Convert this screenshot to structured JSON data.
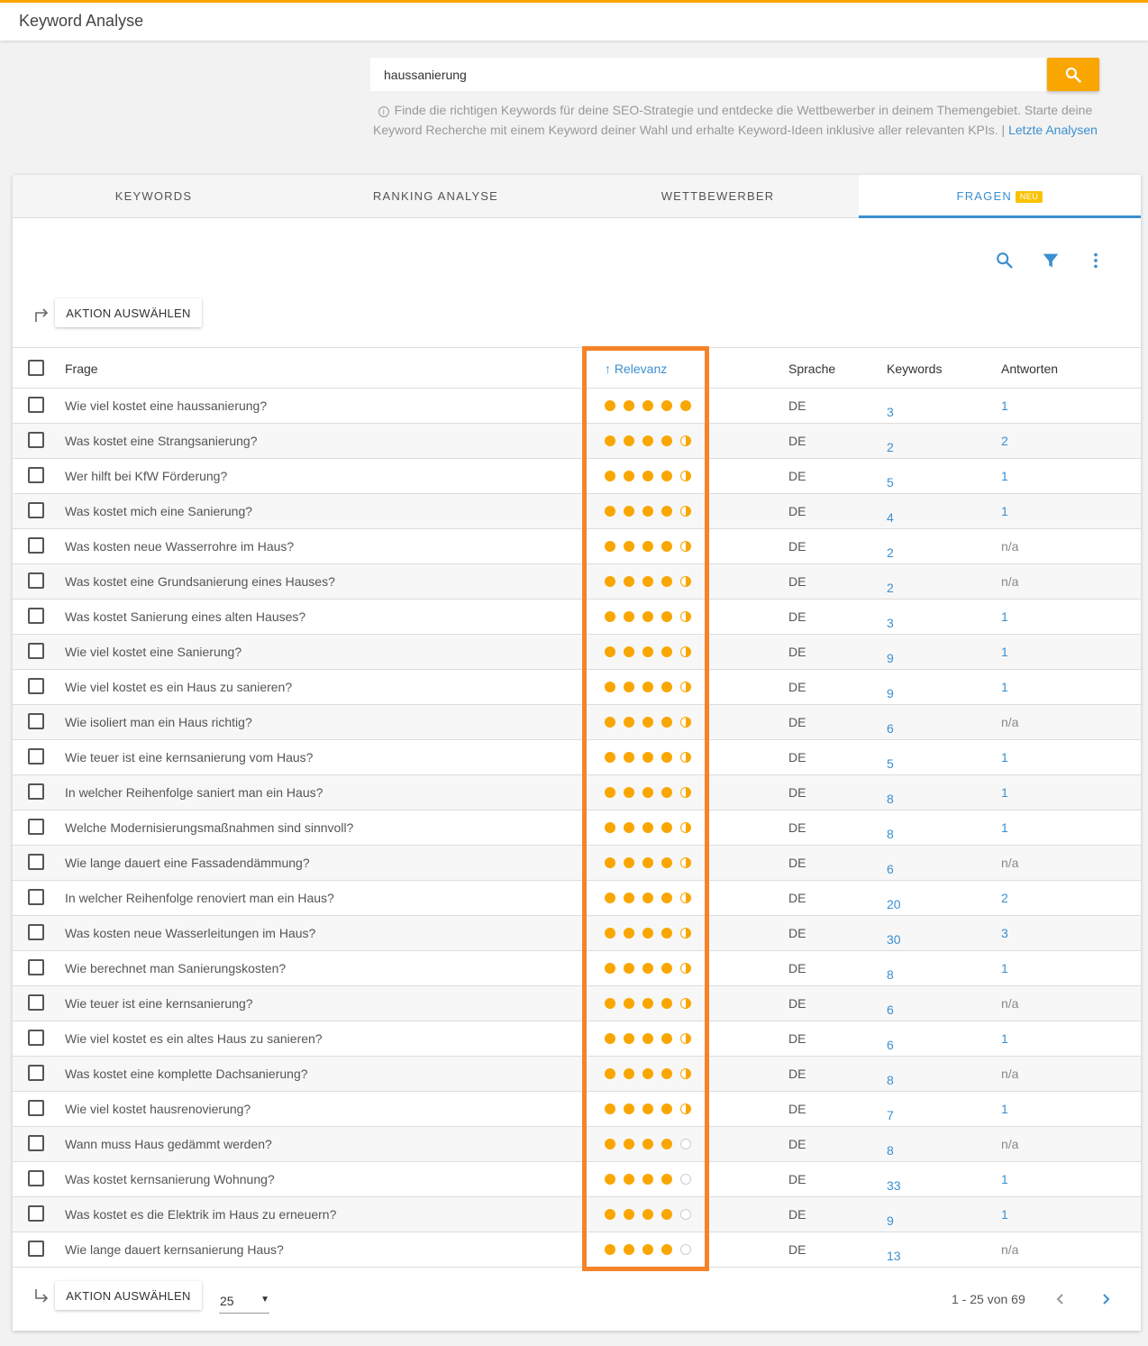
{
  "app": {
    "title": "Keyword Analyse"
  },
  "search": {
    "value": "haussanierung",
    "info_text": "Finde die richtigen Keywords für deine SEO-Strategie und entdecke die Wettbewerber in deinem Themengebiet. Starte deine Keyword Recherche mit einem Keyword deiner Wahl und erhalte Keyword-Ideen inklusive aller relevanten KPIs. |",
    "link_text": "Letzte Analysen"
  },
  "tabs": [
    {
      "label": "KEYWORDS"
    },
    {
      "label": "RANKING ANALYSE"
    },
    {
      "label": "WETTBEWERBER"
    },
    {
      "label": "FRAGEN",
      "badge": "NEU",
      "active": true
    }
  ],
  "toolbar": {
    "icons": [
      "search-icon",
      "filter-icon",
      "more-vert-icon"
    ]
  },
  "action_label": "AKTION AUSWÄHLEN",
  "columns": {
    "frage": "Frage",
    "relevanz": "Relevanz",
    "sprache": "Sprache",
    "keywords": "Keywords",
    "antworten": "Antworten"
  },
  "rows": [
    {
      "frage": "Wie viel kostet eine haussanierung?",
      "relevanz": 5,
      "sprache": "DE",
      "keywords": "3",
      "antworten": "1"
    },
    {
      "frage": "Was kostet eine Strangsanierung?",
      "relevanz": 4.5,
      "sprache": "DE",
      "keywords": "2",
      "antworten": "2"
    },
    {
      "frage": "Wer hilft bei KfW Förderung?",
      "relevanz": 4.5,
      "sprache": "DE",
      "keywords": "5",
      "antworten": "1"
    },
    {
      "frage": "Was kostet mich eine Sanierung?",
      "relevanz": 4.5,
      "sprache": "DE",
      "keywords": "4",
      "antworten": "1"
    },
    {
      "frage": "Was kosten neue Wasserrohre im Haus?",
      "relevanz": 4.5,
      "sprache": "DE",
      "keywords": "2",
      "antworten": "n/a"
    },
    {
      "frage": "Was kostet eine Grundsanierung eines Hauses?",
      "relevanz": 4.5,
      "sprache": "DE",
      "keywords": "2",
      "antworten": "n/a"
    },
    {
      "frage": "Was kostet Sanierung eines alten Hauses?",
      "relevanz": 4.5,
      "sprache": "DE",
      "keywords": "3",
      "antworten": "1"
    },
    {
      "frage": "Wie viel kostet eine Sanierung?",
      "relevanz": 4.5,
      "sprache": "DE",
      "keywords": "9",
      "antworten": "1"
    },
    {
      "frage": "Wie viel kostet es ein Haus zu sanieren?",
      "relevanz": 4.5,
      "sprache": "DE",
      "keywords": "9",
      "antworten": "1"
    },
    {
      "frage": "Wie isoliert man ein Haus richtig?",
      "relevanz": 4.5,
      "sprache": "DE",
      "keywords": "6",
      "antworten": "n/a"
    },
    {
      "frage": "Wie teuer ist eine kernsanierung vom Haus?",
      "relevanz": 4.5,
      "sprache": "DE",
      "keywords": "5",
      "antworten": "1"
    },
    {
      "frage": "In welcher Reihenfolge saniert man ein Haus?",
      "relevanz": 4.5,
      "sprache": "DE",
      "keywords": "8",
      "antworten": "1"
    },
    {
      "frage": "Welche Modernisierungsmaßnahmen sind sinnvoll?",
      "relevanz": 4.5,
      "sprache": "DE",
      "keywords": "8",
      "antworten": "1"
    },
    {
      "frage": "Wie lange dauert eine Fassadendämmung?",
      "relevanz": 4.5,
      "sprache": "DE",
      "keywords": "6",
      "antworten": "n/a"
    },
    {
      "frage": "In welcher Reihenfolge renoviert man ein Haus?",
      "relevanz": 4.5,
      "sprache": "DE",
      "keywords": "20",
      "antworten": "2"
    },
    {
      "frage": "Was kosten neue Wasserleitungen im Haus?",
      "relevanz": 4.5,
      "sprache": "DE",
      "keywords": "30",
      "antworten": "3"
    },
    {
      "frage": "Wie berechnet man Sanierungskosten?",
      "relevanz": 4.5,
      "sprache": "DE",
      "keywords": "8",
      "antworten": "1"
    },
    {
      "frage": "Wie teuer ist eine kernsanierung?",
      "relevanz": 4.5,
      "sprache": "DE",
      "keywords": "6",
      "antworten": "n/a"
    },
    {
      "frage": "Wie viel kostet es ein altes Haus zu sanieren?",
      "relevanz": 4.5,
      "sprache": "DE",
      "keywords": "6",
      "antworten": "1"
    },
    {
      "frage": "Was kostet eine komplette Dachsanierung?",
      "relevanz": 4.5,
      "sprache": "DE",
      "keywords": "8",
      "antworten": "n/a"
    },
    {
      "frage": "Wie viel kostet hausrenovierung?",
      "relevanz": 4.5,
      "sprache": "DE",
      "keywords": "7",
      "antworten": "1"
    },
    {
      "frage": "Wann muss Haus gedämmt werden?",
      "relevanz": 4,
      "sprache": "DE",
      "keywords": "8",
      "antworten": "n/a"
    },
    {
      "frage": "Was kostet kernsanierung Wohnung?",
      "relevanz": 4,
      "sprache": "DE",
      "keywords": "33",
      "antworten": "1"
    },
    {
      "frage": "Was kostet es die Elektrik im Haus zu erneuern?",
      "relevanz": 4,
      "sprache": "DE",
      "keywords": "9",
      "antworten": "1"
    },
    {
      "frage": "Wie lange dauert kernsanierung Haus?",
      "relevanz": 4,
      "sprache": "DE",
      "keywords": "13",
      "antworten": "n/a"
    }
  ],
  "pagination": {
    "page_size": "25",
    "range": "1 - 25 von 69"
  },
  "colors": {
    "accent": "#f9a600",
    "link": "#3b8fd0",
    "highlight": "#f4832a"
  }
}
